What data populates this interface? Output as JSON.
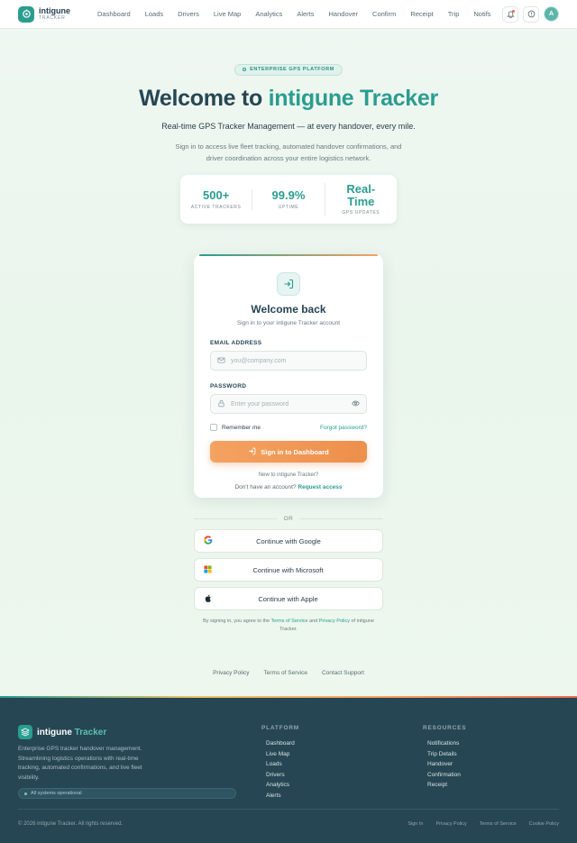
{
  "nav": {
    "brand_name": "intigune",
    "brand_sub": "TRACKER",
    "links": [
      "Dashboard",
      "Loads",
      "Drivers",
      "Live Map",
      "Analytics",
      "Alerts",
      "Handover",
      "Confirm",
      "Receipt",
      "Trip",
      "Notifs"
    ],
    "avatar_initial": "A"
  },
  "hero": {
    "pill": "ENTERPRISE GPS PLATFORM",
    "title_prefix": "Welcome to",
    "title_accent": "intigune Tracker",
    "subtitle": "Real-time GPS Tracker Management — at every handover, every mile.",
    "description": "Sign in to access live fleet tracking, automated handover confirmations, and driver coordination across your entire logistics network.",
    "stats": [
      {
        "value": "500+",
        "label": "ACTIVE TRACKERS"
      },
      {
        "value": "99.9%",
        "label": "UPTIME"
      },
      {
        "value": "Real-Time",
        "label": "GPS UPDATES"
      }
    ]
  },
  "login": {
    "title": "Welcome back",
    "subtitle": "Sign in to your intigune Tracker account",
    "email_label": "EMAIL ADDRESS",
    "email_placeholder": "you@company.com",
    "password_label": "PASSWORD",
    "password_placeholder": "Enter your password",
    "remember_label": "Remember me",
    "forgot_label": "Forgot password?",
    "submit_label": "Sign in to Dashboard",
    "new_to": "New to intigune Tracker?",
    "no_account": "Don't have an account?",
    "request_access": "Request access"
  },
  "social": {
    "or_label": "OR",
    "google": "Continue with Google",
    "microsoft": "Continue with Microsoft",
    "apple": "Continue with Apple"
  },
  "terms": {
    "prefix": "By signing in, you agree to the",
    "tos": "Terms of Service",
    "and": "and",
    "privacy": "Privacy Policy",
    "suffix": "of intigune Tracker."
  },
  "bottom_links": [
    "Privacy Policy",
    "Terms of Service",
    "Contact Support"
  ],
  "footer": {
    "brand_name": "intigune",
    "brand_accent": "Tracker",
    "description": "Enterprise GPS tracker handover management. Streamlining logistics operations with real-time tracking, automated confirmations, and live fleet visibility.",
    "status": "All systems operational",
    "platform_title": "PLATFORM",
    "platform_links": [
      "Dashboard",
      "Live Map",
      "Loads",
      "Drivers",
      "Analytics",
      "Alerts"
    ],
    "resources_title": "RESOURCES",
    "resources_links": [
      "Notifications",
      "Trip Details",
      "Handover",
      "Confirmation",
      "Receipt"
    ],
    "copyright": "© 2026 intigune Tracker. All rights reserved.",
    "links": [
      "Sign In",
      "Privacy Policy",
      "Terms of Service",
      "Cookie Policy"
    ]
  },
  "colors": {
    "accent": "#2a9d8f",
    "cta": "#f4a261",
    "dark": "#264653",
    "alert": "#e76f51"
  },
  "icons": {
    "logo": "location-target-icon",
    "notifications": "bell-icon",
    "security": "shield-icon",
    "login": "sign-in-arrow-icon",
    "email": "mail-icon",
    "password": "lock-icon",
    "show_password": "eye-icon"
  }
}
